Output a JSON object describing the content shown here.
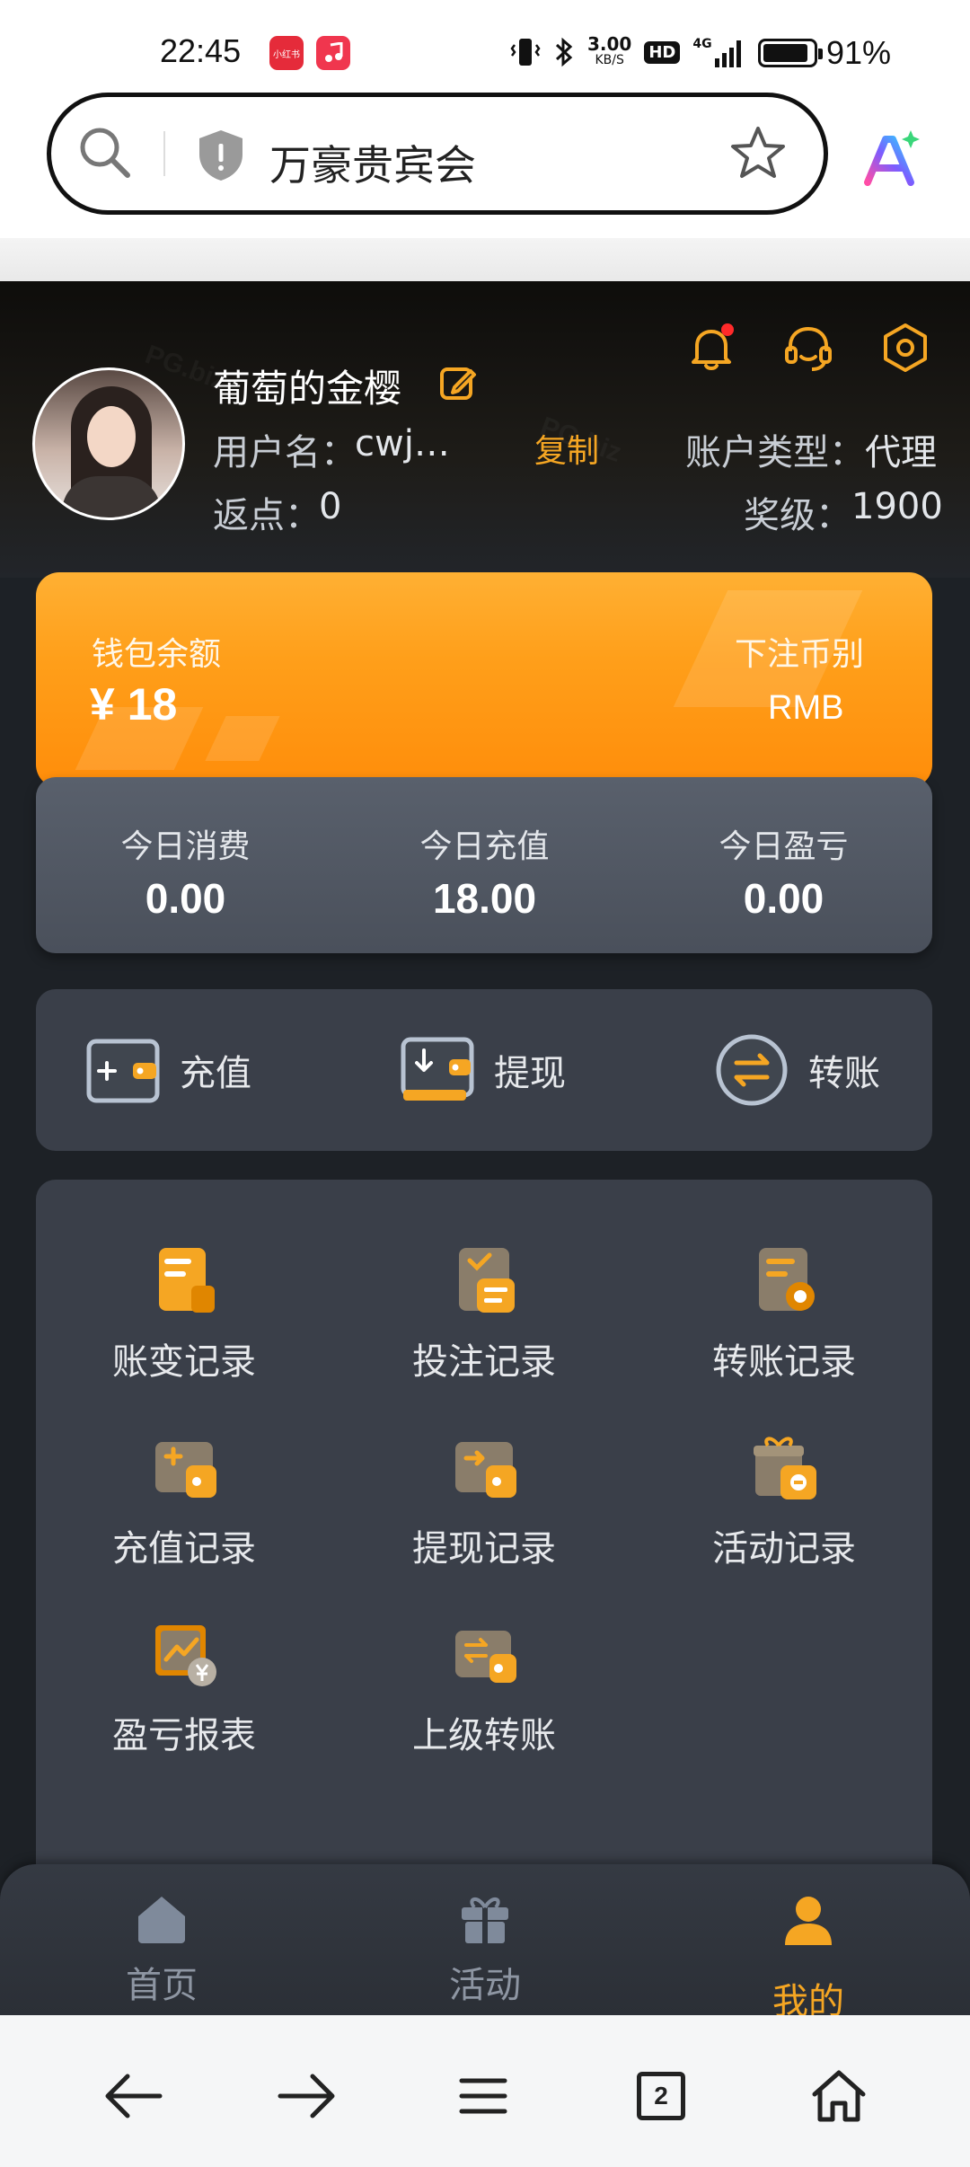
{
  "status_bar": {
    "time": "22:45",
    "app1_label": "小红书",
    "app2_icon": "music-icon",
    "net_speed_value": "3.00",
    "net_speed_unit": "KB/S",
    "hd_label": "HD",
    "signal_label": "4G",
    "battery": "91%"
  },
  "browser": {
    "url_text": "万豪贵宾会",
    "icons": [
      "search-icon",
      "shield-icon",
      "star-icon",
      "ai-icon"
    ]
  },
  "profile": {
    "nickname": "葡萄的金樱",
    "username_label": "用户名：",
    "username_value": "cwj…",
    "copy_label": "复制",
    "account_type_label": "账户类型：",
    "account_type_value": "代理",
    "rebate_label": "返点：",
    "rebate_value": "0",
    "level_label": "奖级：",
    "level_value": "1900"
  },
  "wallet": {
    "balance_label": "钱包余额",
    "balance_value": "¥ 18",
    "currency_label": "下注币别",
    "currency_value": "RMB"
  },
  "today": [
    {
      "label": "今日消费",
      "value": "0.00"
    },
    {
      "label": "今日充值",
      "value": "18.00"
    },
    {
      "label": "今日盈亏",
      "value": "0.00"
    }
  ],
  "actions": [
    {
      "label": "充值",
      "icon": "wallet-add-icon"
    },
    {
      "label": "提现",
      "icon": "withdraw-icon"
    },
    {
      "label": "转账",
      "icon": "transfer-icon"
    }
  ],
  "menu": [
    {
      "label": "账变记录",
      "icon": "ledger-icon"
    },
    {
      "label": "投注记录",
      "icon": "bet-record-icon"
    },
    {
      "label": "转账记录",
      "icon": "transfer-record-icon"
    },
    {
      "label": "充值记录",
      "icon": "deposit-record-icon"
    },
    {
      "label": "提现记录",
      "icon": "withdraw-record-icon"
    },
    {
      "label": "活动记录",
      "icon": "gift-record-icon"
    },
    {
      "label": "盈亏报表",
      "icon": "report-icon"
    },
    {
      "label": "上级转账",
      "icon": "superior-transfer-icon"
    }
  ],
  "tabbar": [
    {
      "label": "首页",
      "icon": "home-icon",
      "active": false
    },
    {
      "label": "活动",
      "icon": "gift-icon",
      "active": false
    },
    {
      "label": "我的",
      "icon": "user-icon",
      "active": true
    }
  ],
  "bottom_nav": {
    "tabs_count": "2"
  },
  "colors": {
    "accent": "#f5a623",
    "wallet_orange": "#ff9f1a",
    "panel": "#3a3f49",
    "page_bg": "#1d2126"
  }
}
